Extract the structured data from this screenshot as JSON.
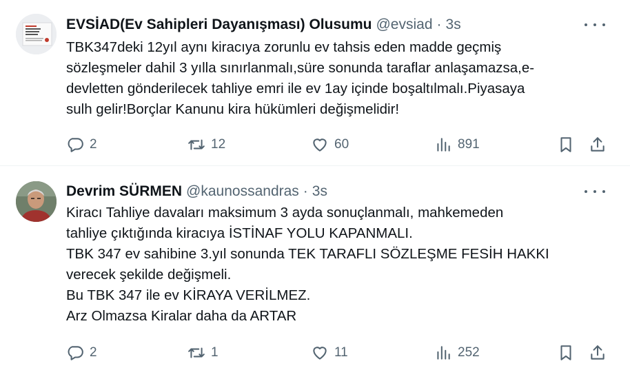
{
  "tweets": [
    {
      "author": "EVSİAD(Ev Sahipleri Dayanışması) Olusumu",
      "handle": "@evsiad",
      "separator": "·",
      "time": "3s",
      "text": "TBK347deki 12yıl aynı kiracıya zorunlu ev tahsis eden madde geçmiş\nsözleşmeler dahil 3 yılla sınırlanmalı,süre sonunda taraflar anlaşamazsa,e-\ndevletten gönderilecek tahliye emri ile ev 1ay içinde boşaltılmalı.Piyasaya\nsulh gelir!Borçlar Kanunu kira hükümleri değişmelidir!",
      "replies": "2",
      "retweets": "12",
      "likes": "60",
      "views": "891"
    },
    {
      "author": "Devrim SÜRMEN",
      "handle": "@kaunossandras",
      "separator": "·",
      "time": "3s",
      "text": "Kiracı Tahliye davaları maksimum 3 ayda sonuçlanmalı, mahkemeden\ntahliye çıktığında kiracıya İSTİNAF YOLU KAPANMALI.\nTBK 347 ev sahibine 3.yıl sonunda TEK TARAFLI SÖZLEŞME FESİH HAKKI\nverecek şekilde değişmeli.\nBu TBK 347 ile ev KİRAYA VERİLMEZ.\nArz Olmazsa Kiralar daha da ARTAR",
      "replies": "2",
      "retweets": "1",
      "likes": "11",
      "views": "252"
    }
  ]
}
